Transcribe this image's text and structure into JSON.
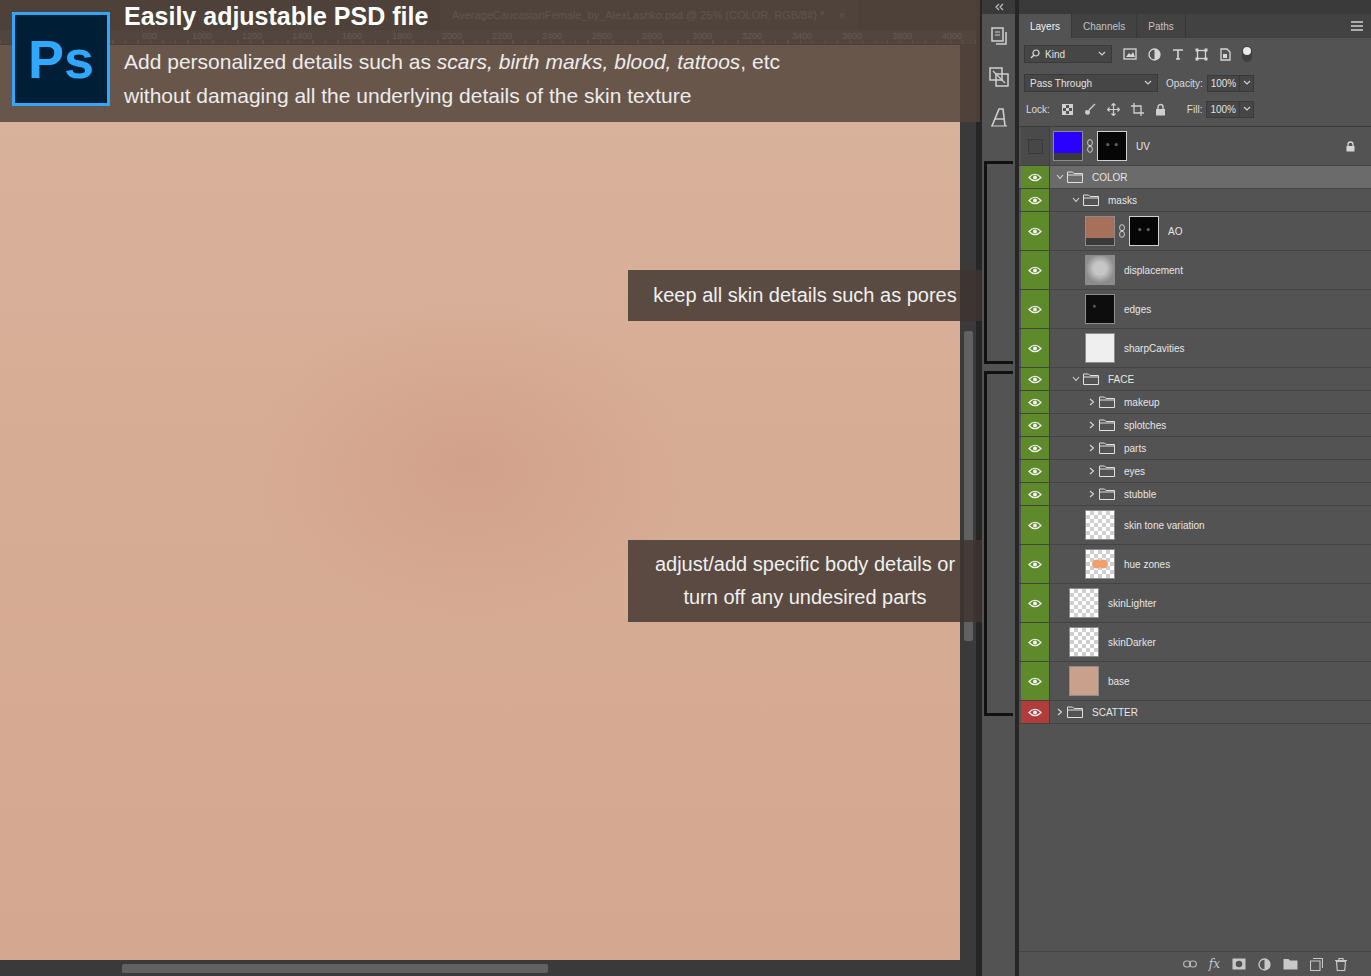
{
  "banner": {
    "logo": "Ps",
    "title": "Easily adjustable PSD file",
    "line1": [
      {
        "text": "Add personalized details such as ",
        "italic": false
      },
      {
        "text": "scars, birth marks, blood, tattoos",
        "italic": true
      },
      {
        "text": ", etc",
        "italic": false
      }
    ],
    "line2": "without damaging all the underlying details of the skin texture"
  },
  "document_tab": {
    "title": "AverageCaucasianFemale_by_AlexLashko.psd @ 25% (COLOR, RGB/8#) *",
    "close": "×"
  },
  "ruler": [
    "800",
    "1000",
    "1200",
    "1400",
    "1600",
    "1800",
    "2000",
    "2200",
    "2400",
    "2600",
    "2800",
    "3000",
    "3200",
    "3400",
    "3600",
    "3800",
    "4000"
  ],
  "annotations": [
    {
      "text": "keep all skin details such as pores"
    },
    {
      "text": "adjust/add specific body details or turn off any undesired parts"
    }
  ],
  "panel_tabs": [
    {
      "label": "Layers",
      "selected": true
    },
    {
      "label": "Channels",
      "selected": false
    },
    {
      "label": "Paths",
      "selected": false
    }
  ],
  "filter": {
    "kind": "Kind"
  },
  "blend": {
    "mode": "Pass Through",
    "opacity_label": "Opacity:",
    "opacity": "100%"
  },
  "lock": {
    "label": "Lock:",
    "fill_label": "Fill:",
    "fill": "100%"
  },
  "layers": [
    {
      "name": "UV",
      "kind": "layer",
      "depth": 0,
      "visible": false,
      "selected": false,
      "expanded": false,
      "thumb": "blue",
      "mask": true,
      "locked": true,
      "color": "#4a4a4a"
    },
    {
      "name": "COLOR",
      "kind": "group",
      "depth": 0,
      "visible": true,
      "selected": true,
      "expanded": true,
      "thumb": "",
      "mask": false,
      "locked": false,
      "color": "#5e8a2c"
    },
    {
      "name": "masks",
      "kind": "group",
      "depth": 1,
      "visible": true,
      "selected": false,
      "expanded": true,
      "thumb": "",
      "mask": false,
      "locked": false,
      "color": "#5e8a2c"
    },
    {
      "name": "AO",
      "kind": "layer",
      "depth": 2,
      "visible": true,
      "selected": false,
      "expanded": false,
      "thumb": "brown",
      "mask": true,
      "locked": false,
      "color": "#5e8a2c"
    },
    {
      "name": "displacement",
      "kind": "layer",
      "depth": 2,
      "visible": true,
      "selected": false,
      "expanded": false,
      "thumb": "gray",
      "mask": false,
      "locked": false,
      "color": "#5e8a2c"
    },
    {
      "name": "edges",
      "kind": "layer",
      "depth": 2,
      "visible": true,
      "selected": false,
      "expanded": false,
      "thumb": "dark",
      "mask": false,
      "locked": false,
      "color": "#5e8a2c"
    },
    {
      "name": "sharpCavities",
      "kind": "layer",
      "depth": 2,
      "visible": true,
      "selected": false,
      "expanded": false,
      "thumb": "white",
      "mask": false,
      "locked": false,
      "color": "#5e8a2c"
    },
    {
      "name": "FACE",
      "kind": "group",
      "depth": 1,
      "visible": true,
      "selected": false,
      "expanded": true,
      "thumb": "",
      "mask": false,
      "locked": false,
      "color": "#5e8a2c"
    },
    {
      "name": "makeup",
      "kind": "group",
      "depth": 2,
      "visible": true,
      "selected": false,
      "expanded": false,
      "thumb": "",
      "mask": false,
      "locked": false,
      "color": "#5e8a2c"
    },
    {
      "name": "splotches",
      "kind": "group",
      "depth": 2,
      "visible": true,
      "selected": false,
      "expanded": false,
      "thumb": "",
      "mask": false,
      "locked": false,
      "color": "#5e8a2c"
    },
    {
      "name": "parts",
      "kind": "group",
      "depth": 2,
      "visible": true,
      "selected": false,
      "expanded": false,
      "thumb": "",
      "mask": false,
      "locked": false,
      "color": "#5e8a2c"
    },
    {
      "name": "eyes",
      "kind": "group",
      "depth": 2,
      "visible": true,
      "selected": false,
      "expanded": false,
      "thumb": "",
      "mask": false,
      "locked": false,
      "color": "#5e8a2c"
    },
    {
      "name": "stubble",
      "kind": "group",
      "depth": 2,
      "visible": true,
      "selected": false,
      "expanded": false,
      "thumb": "",
      "mask": false,
      "locked": false,
      "color": "#5e8a2c"
    },
    {
      "name": "skin tone variation",
      "kind": "layer",
      "depth": 2,
      "visible": true,
      "selected": false,
      "expanded": false,
      "thumb": "checker",
      "mask": false,
      "locked": false,
      "color": "#5e8a2c"
    },
    {
      "name": "hue zones",
      "kind": "layer",
      "depth": 2,
      "visible": true,
      "selected": false,
      "expanded": false,
      "thumb": "hue",
      "mask": false,
      "locked": false,
      "color": "#5e8a2c"
    },
    {
      "name": "skinLighter",
      "kind": "layer",
      "depth": 1,
      "visible": true,
      "selected": false,
      "expanded": false,
      "thumb": "checker",
      "mask": false,
      "locked": false,
      "color": "#5e8a2c"
    },
    {
      "name": "skinDarker",
      "kind": "layer",
      "depth": 1,
      "visible": true,
      "selected": false,
      "expanded": false,
      "thumb": "checker",
      "mask": false,
      "locked": false,
      "color": "#5e8a2c"
    },
    {
      "name": "base",
      "kind": "layer",
      "depth": 1,
      "visible": true,
      "selected": false,
      "expanded": false,
      "thumb": "peach",
      "mask": false,
      "locked": false,
      "color": "#5e8a2c"
    },
    {
      "name": "SCATTER",
      "kind": "group",
      "depth": 0,
      "visible": true,
      "selected": false,
      "expanded": false,
      "thumb": "",
      "mask": false,
      "locked": false,
      "color": "#b23b3b"
    }
  ],
  "footer": {
    "fx": "fx"
  }
}
